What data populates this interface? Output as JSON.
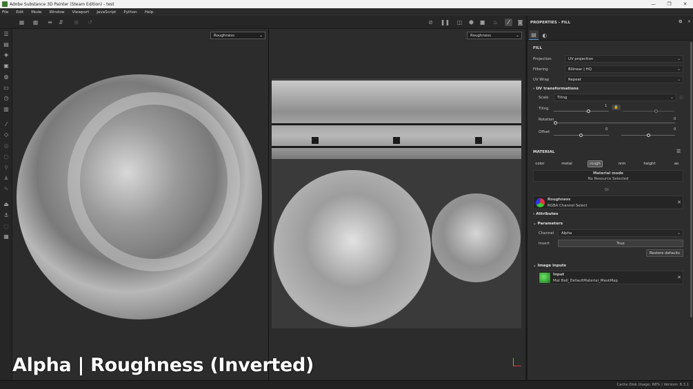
{
  "window": {
    "title": "Adobe Substance 3D Painter (Steam Edition) - test",
    "buttons": {
      "minimize": "—",
      "maximize": "❐",
      "close": "✕"
    }
  },
  "menu": [
    "File",
    "Edit",
    "Mode",
    "Window",
    "Viewport",
    "JavaScript",
    "Python",
    "Help"
  ],
  "viewports": {
    "left_channel": "Roughness",
    "right_channel": "Roughness",
    "caption": "Alpha | Roughness (Inverted)"
  },
  "status": {
    "text": "Cache Disk Usage: 68% | Version: 8.3.1"
  },
  "properties": {
    "title": "PROPERTIES - FILL",
    "fill": {
      "section": "FILL",
      "projection_label": "Projection",
      "projection_value": "UV projection",
      "filtering_label": "Filtering",
      "filtering_value": "Bilinear | HQ",
      "uvwrap_label": "UV Wrap",
      "uvwrap_value": "Repeat",
      "uvtrans_section": "UV transformations",
      "scale_label": "Scale",
      "scale_value": "Tiling",
      "tiling_label": "Tiling",
      "tiling_value": "1",
      "rotation_label": "Rotation",
      "rotation_value": "0",
      "offset_label": "Offset",
      "offset_u": "0",
      "offset_v": "0"
    },
    "material": {
      "section": "MATERIAL",
      "channels": [
        "color",
        "metal",
        "rough",
        "nrm",
        "height",
        "ao"
      ],
      "active_channel": "rough",
      "mode_title": "Material mode",
      "mode_value": "No Resource Selected",
      "or_text": "Or"
    },
    "roughness": {
      "name": "Roughness",
      "sub": "RGBA Channel Select",
      "attributes": "Attributes",
      "parameters": "Parameters",
      "channel_label": "Channel",
      "channel_value": "Alpha",
      "invert_label": "Invert",
      "invert_value": "True",
      "restore": "Restore defaults"
    },
    "image_inputs": {
      "section": "Image inputs",
      "input_name": "Input",
      "input_value": "Mat Ball_DefaultMaterial_MaskMap"
    }
  },
  "colors": {
    "accent": "#5aa0e6",
    "panel": "#2d2d2d",
    "viewport": "#2c2c2c"
  }
}
